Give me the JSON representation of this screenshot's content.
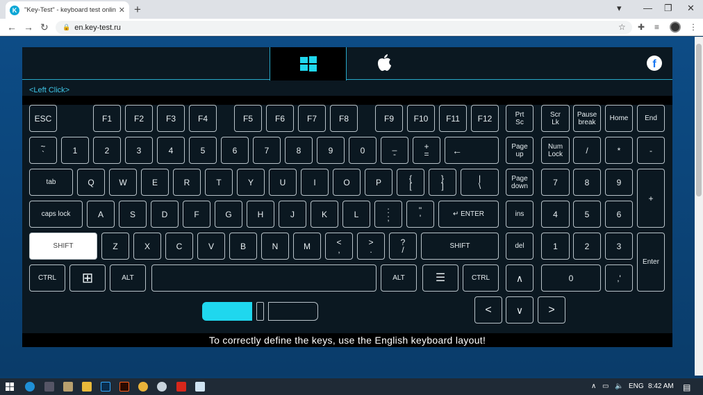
{
  "browser": {
    "tab_title": "\"Key-Test\" - keyboard test online",
    "tab_favicon": "K",
    "url": "en.key-test.ru",
    "new_tab": "+",
    "close_tab": "✕",
    "back": "←",
    "forward": "→",
    "reload": "↻",
    "minimize": "—",
    "maximize": "❐",
    "close": "✕",
    "profile_menu": "▾"
  },
  "app": {
    "os_windows_icon": "windows-icon",
    "os_mac_icon": "apple-icon",
    "facebook_icon": "f",
    "click_info": "<Left Click>",
    "footer_text": "To correctly define the keys, use the English keyboard layout!"
  },
  "keys": {
    "esc": "ESC",
    "f1": "F1",
    "f2": "F2",
    "f3": "F3",
    "f4": "F4",
    "f5": "F5",
    "f6": "F6",
    "f7": "F7",
    "f8": "F8",
    "f9": "F9",
    "f10": "F10",
    "f11": "F11",
    "f12": "F12",
    "prtsc_1": "Prt",
    "prtsc_2": "Sc",
    "scrlk_1": "Scr",
    "scrlk_2": "Lk",
    "pause_1": "Pause",
    "pause_2": "break",
    "home": "Home",
    "end": "End",
    "tilde_1": "~",
    "tilde_2": "`",
    "d1": "1",
    "d2": "2",
    "d3": "3",
    "d4": "4",
    "d5": "5",
    "d6": "6",
    "d7": "7",
    "d8": "8",
    "d9": "9",
    "d0": "0",
    "minus_1": "_",
    "minus_2": "-",
    "plus_1": "+",
    "plus_2": "=",
    "backspace": "←",
    "pgup_1": "Page",
    "pgup_2": "up",
    "numlock_1": "Num",
    "numlock_2": "Lock",
    "np_div": "/",
    "np_mul": "*",
    "np_sub": "-",
    "tab": "tab",
    "q": "Q",
    "w": "W",
    "e": "E",
    "r": "R",
    "t": "T",
    "y": "Y",
    "u": "U",
    "i": "I",
    "o": "O",
    "p": "P",
    "lbr_1": "{",
    "lbr_2": "[",
    "rbr_1": "}",
    "rbr_2": "]",
    "bsl_1": "|",
    "bsl_2": "\\",
    "pgdn_1": "Page",
    "pgdn_2": "down",
    "np7": "7",
    "np8": "8",
    "np9": "9",
    "np_add": "+",
    "capslock": "caps lock",
    "a": "A",
    "s": "S",
    "d": "D",
    "f": "F",
    "g": "G",
    "h": "H",
    "j": "J",
    "k": "K",
    "l": "L",
    "semi_1": ":",
    "semi_2": ";",
    "quote_1": "\"",
    "quote_2": "'",
    "enter": "↵ ENTER",
    "ins": "ins",
    "np4": "4",
    "np5": "5",
    "np6": "6",
    "lshift": "SHIFT",
    "z": "Z",
    "x": "X",
    "c": "C",
    "v": "V",
    "b": "B",
    "n": "N",
    "m": "M",
    "comma_1": "<",
    "comma_2": ",",
    "period_1": ">",
    "period_2": ".",
    "slash_1": "?",
    "slash_2": "/",
    "rshift": "SHIFT",
    "del": "del",
    "np1": "1",
    "np2": "2",
    "np3": "3",
    "np_enter": "Enter",
    "lctrl": "CTRL",
    "win": "⊞",
    "lalt": "ALT",
    "ralt": "ALT",
    "menu": "☰",
    "rctrl": "CTRL",
    "up": "∧",
    "np0": "0",
    "np_dot": ",'",
    "left": "<",
    "down": "∨",
    "right": ">"
  },
  "taskbar": {
    "lang": "ENG",
    "time": "8:42 AM"
  },
  "colors": {
    "accent": "#1fd7ee",
    "page_bg": "#0d4c86",
    "keyboard_bg": "#0b1821"
  }
}
